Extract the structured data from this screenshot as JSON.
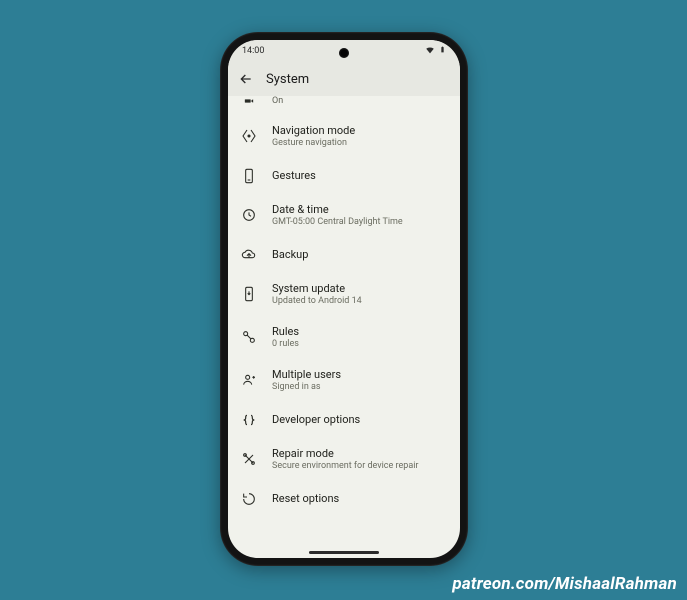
{
  "watermark": "patreon.com/MishaalRahman",
  "status": {
    "time": "14:00"
  },
  "appbar": {
    "title": "System"
  },
  "partial_sub": "On",
  "items": [
    {
      "icon": "nav",
      "title": "Navigation mode",
      "sub": "Gesture navigation"
    },
    {
      "icon": "gestures",
      "title": "Gestures",
      "sub": ""
    },
    {
      "icon": "clock",
      "title": "Date & time",
      "sub": "GMT-05:00 Central Daylight Time"
    },
    {
      "icon": "backup",
      "title": "Backup",
      "sub": ""
    },
    {
      "icon": "update",
      "title": "System update",
      "sub": "Updated to Android 14"
    },
    {
      "icon": "rules",
      "title": "Rules",
      "sub": "0 rules"
    },
    {
      "icon": "users",
      "title": "Multiple users",
      "sub": "Signed in as"
    },
    {
      "icon": "dev",
      "title": "Developer options",
      "sub": ""
    },
    {
      "icon": "repair",
      "title": "Repair mode",
      "sub": "Secure environment for device repair"
    },
    {
      "icon": "reset",
      "title": "Reset options",
      "sub": ""
    }
  ]
}
